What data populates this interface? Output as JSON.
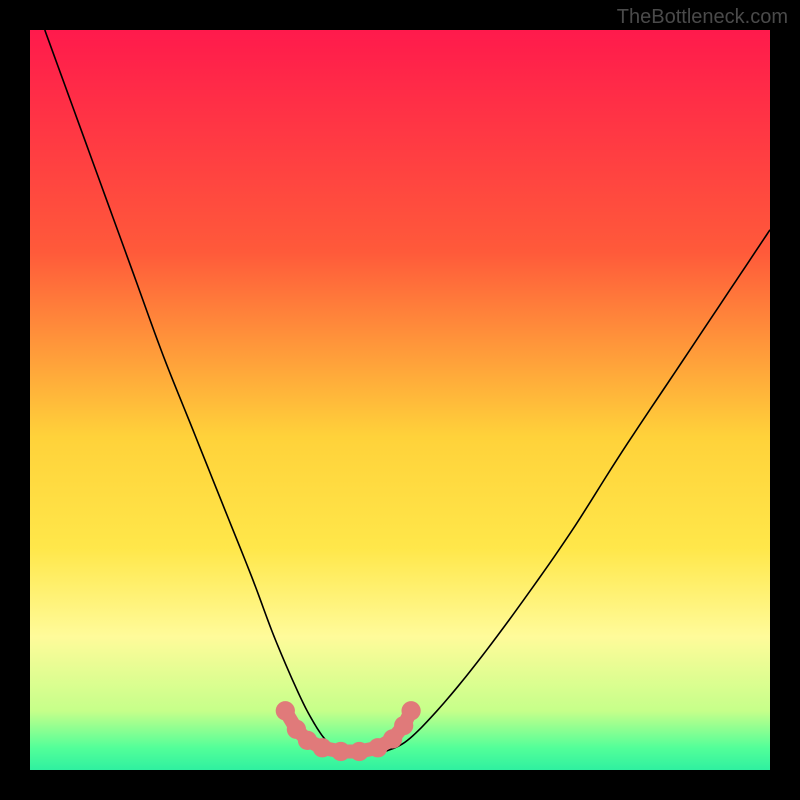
{
  "watermark": "TheBottleneck.com",
  "chart_data": {
    "type": "line",
    "title": "",
    "xlabel": "",
    "ylabel": "",
    "xlim": [
      0,
      100
    ],
    "ylim": [
      0,
      100
    ],
    "background_gradient": {
      "stops": [
        {
          "offset": 0.0,
          "color": "#ff1a4c"
        },
        {
          "offset": 0.3,
          "color": "#ff5a3a"
        },
        {
          "offset": 0.55,
          "color": "#ffd23a"
        },
        {
          "offset": 0.7,
          "color": "#ffe74a"
        },
        {
          "offset": 0.82,
          "color": "#fffb9a"
        },
        {
          "offset": 0.92,
          "color": "#c6ff8a"
        },
        {
          "offset": 0.97,
          "color": "#53ff99"
        },
        {
          "offset": 1.0,
          "color": "#2ff0a0"
        }
      ]
    },
    "series": [
      {
        "name": "bottleneck-curve",
        "type": "line",
        "color": "#000000",
        "x": [
          2,
          6,
          10,
          14,
          18,
          22,
          26,
          30,
          33,
          36,
          38,
          40,
          42,
          44,
          46,
          48,
          51,
          55,
          60,
          66,
          73,
          80,
          88,
          96,
          100
        ],
        "y": [
          100,
          89,
          78,
          67,
          56,
          46,
          36,
          26,
          18,
          11,
          7,
          4,
          2.5,
          2,
          2,
          2.5,
          4,
          8,
          14,
          22,
          32,
          43,
          55,
          67,
          73
        ]
      }
    ],
    "marker_band": {
      "color": "#e07a7a",
      "x": [
        34.5,
        36.0,
        37.5,
        39.5,
        42.0,
        44.5,
        47.0,
        49.0,
        50.5,
        51.5
      ],
      "y": [
        8.0,
        5.5,
        4.0,
        3.0,
        2.5,
        2.5,
        3.0,
        4.2,
        6.0,
        8.0
      ],
      "radius": 1.3
    }
  }
}
